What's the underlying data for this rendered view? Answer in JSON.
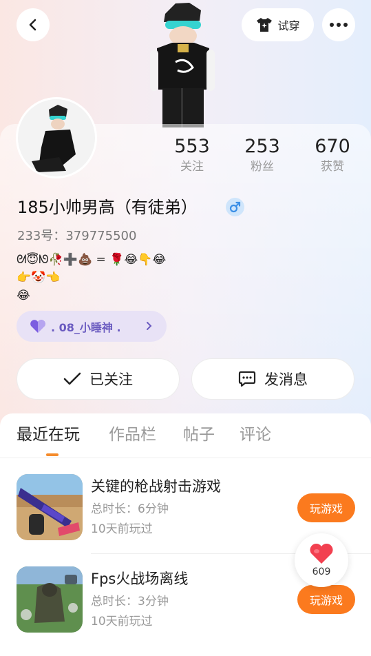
{
  "header": {
    "tryon_label": "试穿"
  },
  "stats": [
    {
      "value": "553",
      "label": "关注"
    },
    {
      "value": "253",
      "label": "粉丝"
    },
    {
      "value": "670",
      "label": "获赞"
    }
  ],
  "profile": {
    "name": "185小帅男高（有徒弟）",
    "uid": "233号：379775500",
    "signature_lines": [
      "ᘛ😇ᘚ🥀➕💩 = 🌹😂👇😂",
      "👉🤡👈",
      "😂"
    ],
    "tag_label": ". 08_小睡神 ."
  },
  "actions": {
    "follow_label": "已关注",
    "message_label": "发消息"
  },
  "tabs": [
    "最近在玩",
    "作品栏",
    "帖子",
    "评论"
  ],
  "games": [
    {
      "title": "关键的枪战射击游戏",
      "duration": "总时长：6分钟",
      "ago": "10天前玩过",
      "play_label": "玩游戏"
    },
    {
      "title": "Fps火战场离线",
      "duration": "总时长：3分钟",
      "ago": "10天前玩过",
      "play_label": "玩游戏"
    }
  ],
  "like": {
    "count": "609"
  },
  "colors": {
    "accent": "#fb7a1e",
    "tag_text": "#6a5bc0",
    "gender_badge": "#cfe5fb"
  },
  "icons": [
    "back-icon",
    "shirt-sparkle-icon",
    "more-icon",
    "male-icon",
    "heart-icon",
    "chevron-right-icon",
    "check-icon",
    "chat-icon"
  ]
}
